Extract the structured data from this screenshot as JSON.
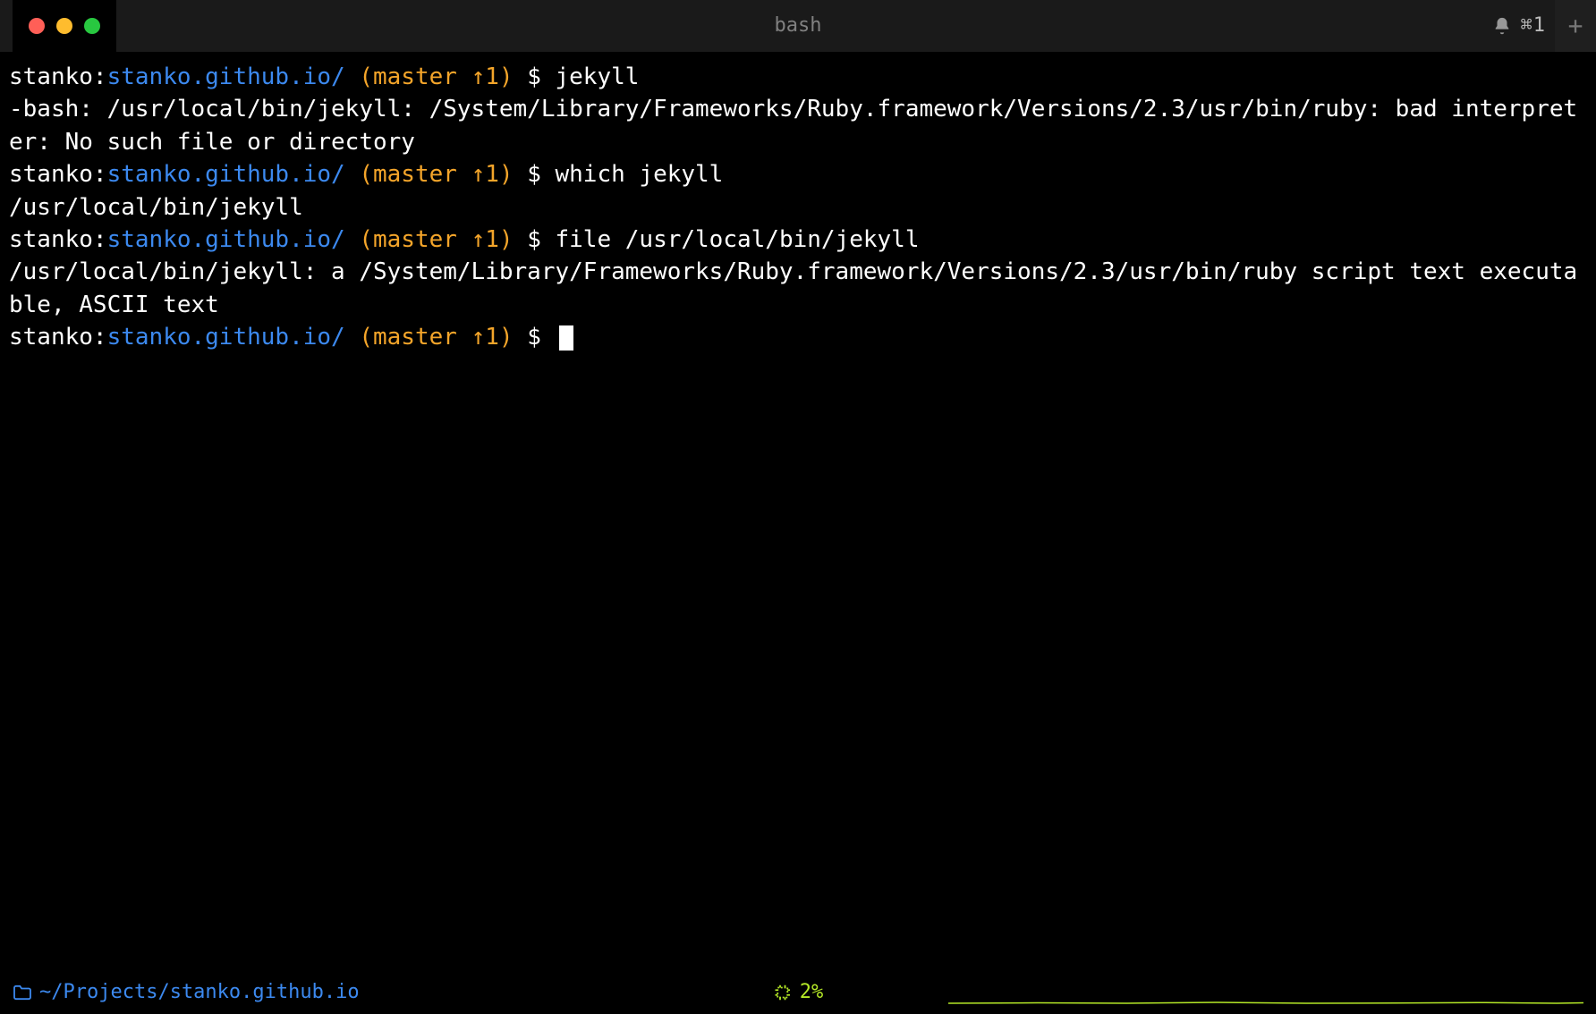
{
  "titlebar": {
    "title": "bash",
    "shortcut": "⌘1"
  },
  "prompt": {
    "user": "stanko",
    "sep1": ":",
    "dir": "stanko.github.io/",
    "git": "(master ↑1)",
    "symbol": "$"
  },
  "lines": [
    {
      "type": "prompt",
      "cmd": "jekyll"
    },
    {
      "type": "output",
      "text": "-bash: /usr/local/bin/jekyll: /System/Library/Frameworks/Ruby.framework/Versions/2.3/usr/bin/ruby: bad interpreter: No such file or directory"
    },
    {
      "type": "prompt",
      "cmd": "which jekyll"
    },
    {
      "type": "output",
      "text": "/usr/local/bin/jekyll"
    },
    {
      "type": "prompt",
      "cmd": "file /usr/local/bin/jekyll"
    },
    {
      "type": "output",
      "text": "/usr/local/bin/jekyll: a /System/Library/Frameworks/Ruby.framework/Versions/2.3/usr/bin/ruby script text executable, ASCII text"
    },
    {
      "type": "prompt",
      "cmd": "",
      "cursor": true
    }
  ],
  "statusbar": {
    "path": "~/Projects/stanko.github.io",
    "cpu": "2%"
  }
}
